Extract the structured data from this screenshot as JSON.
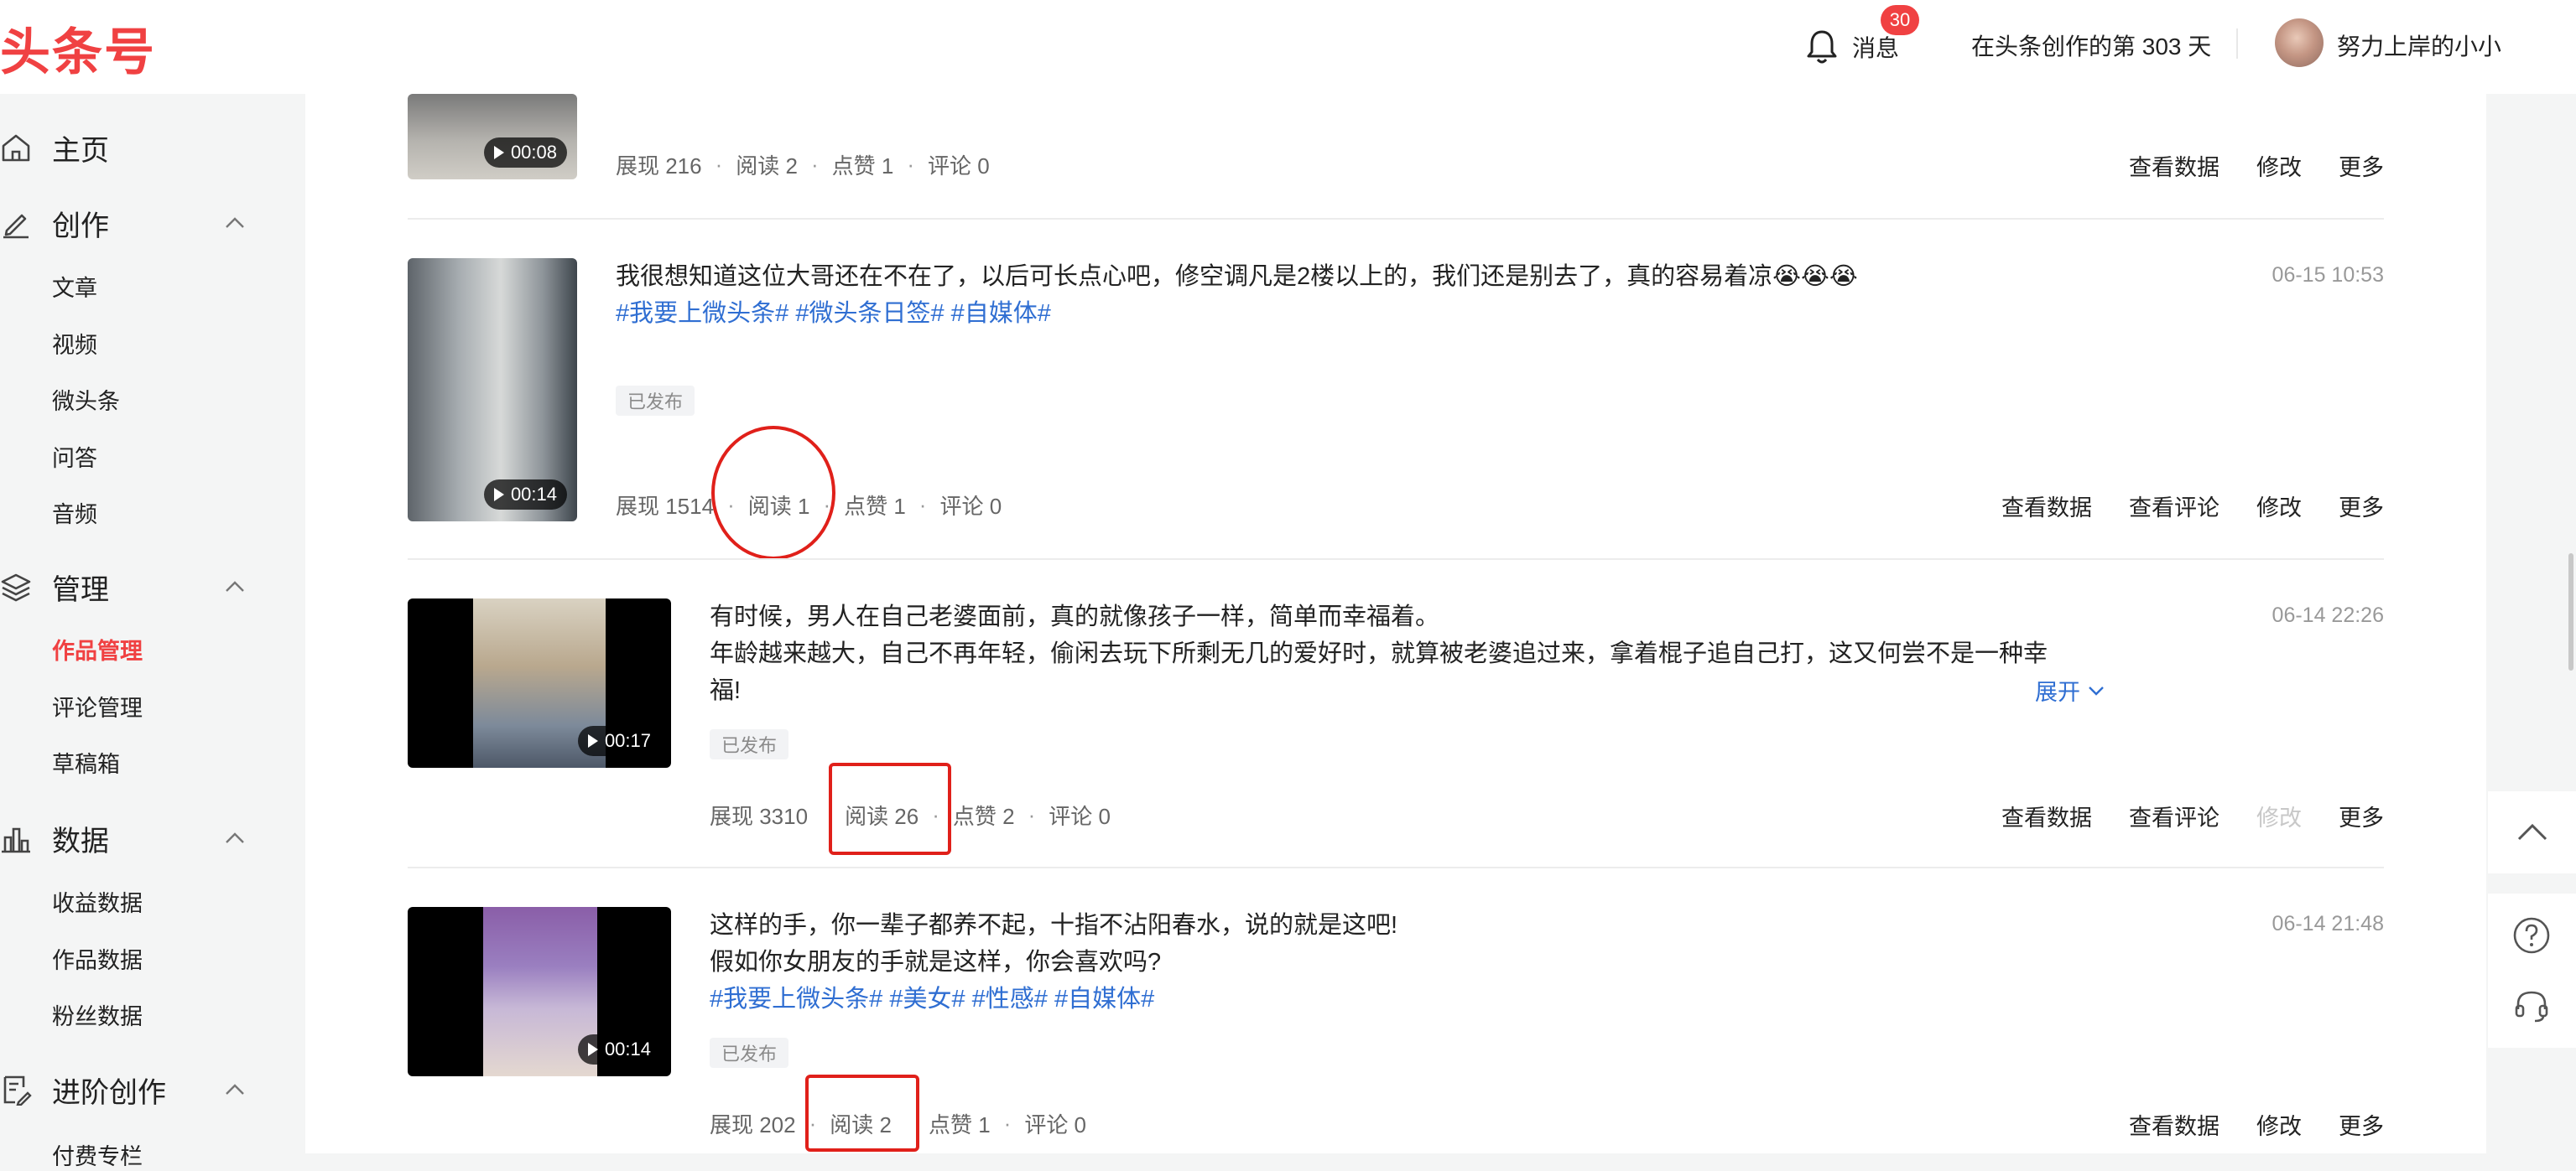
{
  "header": {
    "logo": "头条号",
    "messages_label": "消息",
    "messages_badge": "30",
    "creation_days": "在头条创作的第 303 天",
    "username": "努力上岸的小小"
  },
  "sidebar": {
    "home": "主页",
    "create": {
      "label": "创作",
      "items": [
        "文章",
        "视频",
        "微头条",
        "问答",
        "音频"
      ]
    },
    "manage": {
      "label": "管理",
      "items": [
        "作品管理",
        "评论管理",
        "草稿箱"
      ],
      "active": "作品管理"
    },
    "data": {
      "label": "数据",
      "items": [
        "收益数据",
        "作品数据",
        "粉丝数据"
      ]
    },
    "advanced": {
      "label": "进阶创作",
      "items": [
        "付费专栏"
      ]
    }
  },
  "posts": [
    {
      "duration": "00:08",
      "stats": {
        "impressions": "展现 216",
        "reads": "阅读 2",
        "likes": "点赞 1",
        "comments": "评论 0"
      },
      "actions": [
        "查看数据",
        "修改",
        "更多"
      ]
    },
    {
      "title": "我很想知道这位大哥还在不在了，以后可长点心吧，修空调凡是2楼以上的，我们还是别去了，真的容易着凉😭😭😭",
      "tags": "#我要上微头条# #微头条日签# #自媒体#",
      "status": "已发布",
      "time": "06-15 10:53",
      "duration": "00:14",
      "stats": {
        "impressions": "展现 1514",
        "reads": "阅读 1",
        "likes": "点赞 1",
        "comments": "评论 0"
      },
      "actions": [
        "查看数据",
        "查看评论",
        "修改",
        "更多"
      ]
    },
    {
      "title": "有时候，男人在自己老婆面前，真的就像孩子一样，简单而幸福着。",
      "body_line1": "年龄越来越大，自己不再年轻，偷闲去玩下所剩无几的爱好时，就算被老婆追过来，拿着棍子追自己打，这又何尝不是一种幸",
      "body_line2": "福!",
      "expand": "展开",
      "status": "已发布",
      "time": "06-14 22:26",
      "duration": "00:17",
      "stats": {
        "impressions": "展现 3310",
        "reads": "阅读 26",
        "likes": "点赞 2",
        "comments": "评论 0"
      },
      "actions": [
        "查看数据",
        "查看评论",
        "修改",
        "更多"
      ]
    },
    {
      "title": "这样的手，你一辈子都养不起，十指不沾阳春水，说的就是这吧!",
      "body_line1": "假如你女朋友的手就是这样，你会喜欢吗?",
      "tags": "#我要上微头条# #美女# #性感# #自媒体#",
      "status": "已发布",
      "time": "06-14 21:48",
      "duration": "00:14",
      "stats": {
        "impressions": "展现 202",
        "reads": "阅读 2",
        "likes": "点赞 1",
        "comments": "评论 0"
      },
      "actions": [
        "查看数据",
        "修改",
        "更多"
      ]
    }
  ],
  "colors": {
    "brand": "#f04142",
    "link": "#2f6ed2",
    "annotation": "#e0201a"
  }
}
